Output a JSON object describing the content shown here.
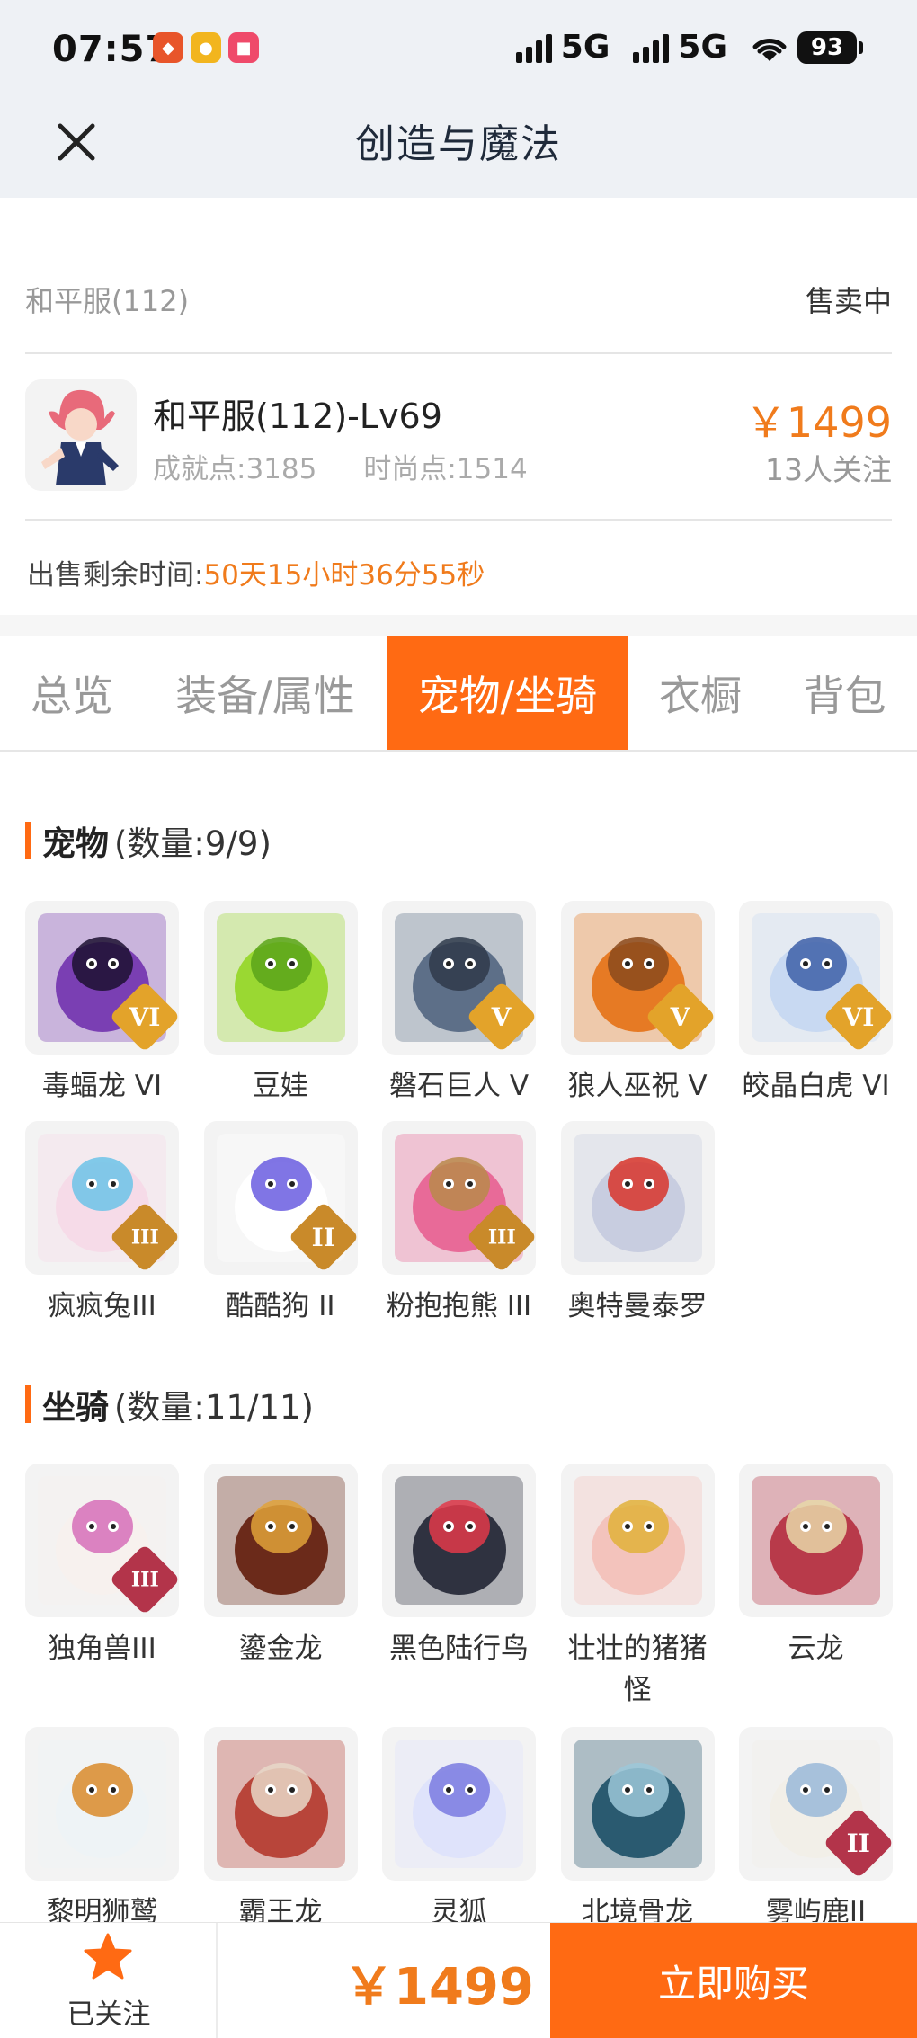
{
  "status_bar": {
    "time": "07:57",
    "network1": "5G",
    "network2": "5G",
    "battery": "93"
  },
  "header": {
    "title": "创造与魔法",
    "close_icon": "close-icon"
  },
  "listing": {
    "server": "和平服(112)",
    "sale_status": "售卖中",
    "role_name": "和平服(112)-Lv69",
    "achievement": "成就点:3185",
    "fashion": "时尚点:1514",
    "price": "￥1499",
    "watchers": "13人关注",
    "remain_label": "出售剩余时间:",
    "remain_value": "50天15小时36分55秒"
  },
  "tabs": [
    {
      "label": "总览"
    },
    {
      "label": "装备/属性"
    },
    {
      "label": "宠物/坐骑",
      "active": true
    },
    {
      "label": "衣橱"
    },
    {
      "label": "背包"
    }
  ],
  "pets": {
    "title": "宠物",
    "count": "(数量:9/9)",
    "items": [
      {
        "name": "毒蝠龙 VI",
        "badge": "VI",
        "badge_color": "#e3a32a",
        "colors": [
          "#7a3fb3",
          "#1c1030"
        ]
      },
      {
        "name": "豆娃",
        "badge": "",
        "badge_color": "",
        "colors": [
          "#9ad832",
          "#5aa51a"
        ]
      },
      {
        "name": "磐石巨人 V",
        "badge": "V",
        "badge_color": "#e3a32a",
        "colors": [
          "#5d6f88",
          "#2f3a4a"
        ]
      },
      {
        "name": "狼人巫祝 V",
        "badge": "V",
        "badge_color": "#e3a32a",
        "colors": [
          "#e67a24",
          "#8a4a1c"
        ]
      },
      {
        "name": "皎晶白虎 VI",
        "badge": "VI",
        "badge_color": "#e3a32a",
        "colors": [
          "#c8d9f2",
          "#3d5fa8"
        ]
      },
      {
        "name": "疯疯兔III",
        "badge": "III",
        "badge_color": "#c98a2a",
        "colors": [
          "#f6dbe8",
          "#6cc3e8"
        ]
      },
      {
        "name": "酷酷狗 II",
        "badge": "II",
        "badge_color": "#c98a2a",
        "colors": [
          "#ffffff",
          "#6a5de0"
        ]
      },
      {
        "name": "粉抱抱熊 III",
        "badge": "III",
        "badge_color": "#c98a2a",
        "colors": [
          "#e86a98",
          "#b88a4a"
        ]
      },
      {
        "name": "奥特曼泰罗",
        "badge": "",
        "badge_color": "",
        "colors": [
          "#c8cde0",
          "#d8342a"
        ]
      }
    ]
  },
  "mounts": {
    "title": "坐骑",
    "count": "(数量:11/11)",
    "items": [
      {
        "name": "独角兽III",
        "badge": "III",
        "badge_color": "#b3344a",
        "colors": [
          "#f7f1ee",
          "#d66fb8"
        ]
      },
      {
        "name": "鎏金龙",
        "badge": "",
        "badge_color": "",
        "colors": [
          "#6b2a1a",
          "#e0a23a"
        ]
      },
      {
        "name": "黑色陆行鸟",
        "badge": "",
        "badge_color": "",
        "colors": [
          "#2f3240",
          "#e23a4a"
        ]
      },
      {
        "name": "壮壮的猪猪怪",
        "badge": "",
        "badge_color": "",
        "colors": [
          "#f3c3bc",
          "#e0b23a"
        ]
      },
      {
        "name": "云龙",
        "badge": "",
        "badge_color": "",
        "colors": [
          "#b83a4a",
          "#e8d8a8"
        ]
      },
      {
        "name": "黎明狮鹫",
        "badge": "",
        "badge_color": "",
        "colors": [
          "#eef3f6",
          "#d98a2a"
        ]
      },
      {
        "name": "霸王龙",
        "badge": "",
        "badge_color": "",
        "colors": [
          "#b8453a",
          "#e8d8c8"
        ]
      },
      {
        "name": "灵狐",
        "badge": "",
        "badge_color": "",
        "colors": [
          "#dfe3fb",
          "#7a7ae0"
        ]
      },
      {
        "name": "北境骨龙",
        "badge": "",
        "badge_color": "",
        "colors": [
          "#2a5a70",
          "#9cc8d8"
        ]
      },
      {
        "name": "雾屿鹿II",
        "badge": "II",
        "badge_color": "#b3344a",
        "colors": [
          "#f2efe8",
          "#9ab8d8"
        ]
      }
    ]
  },
  "bottom_bar": {
    "follow_label": "已关注",
    "price": "￥1499",
    "buy_label": "立即购买"
  },
  "colors": {
    "accent": "#ff6a13",
    "price": "#f07b1c"
  }
}
